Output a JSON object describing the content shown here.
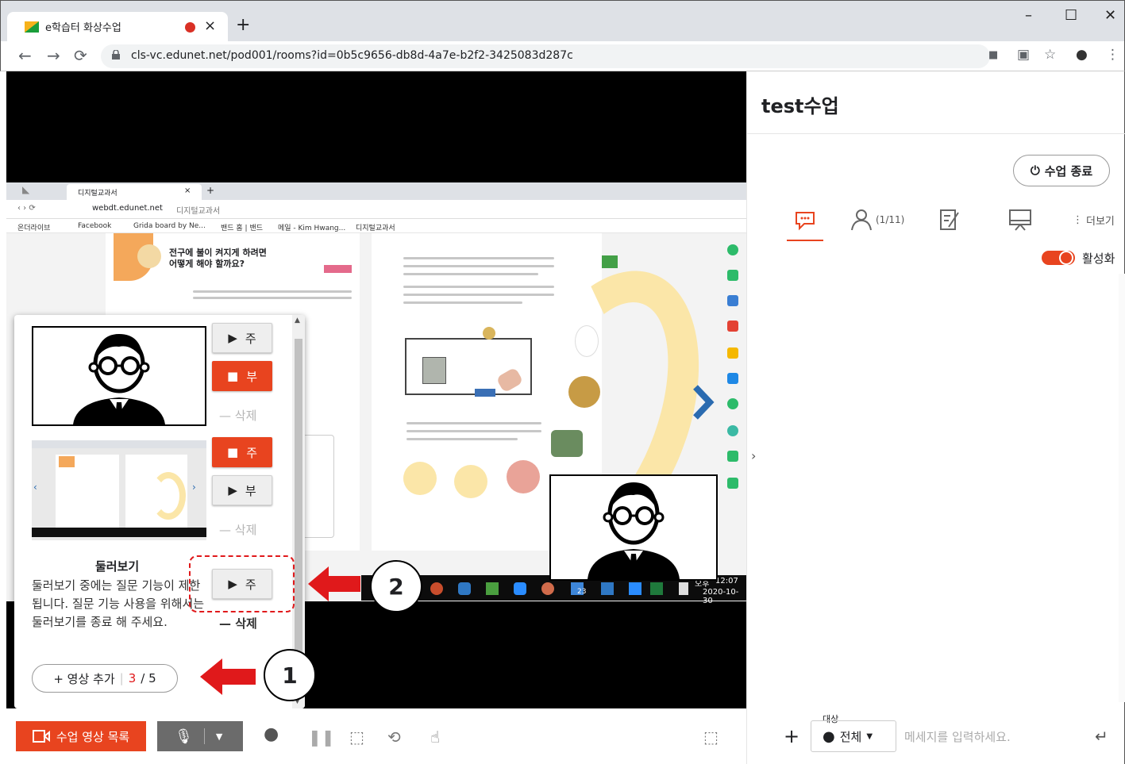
{
  "browser": {
    "tab_title": "e학습터 화상수업",
    "close_tab": "×",
    "new_tab": "+",
    "url": "cls-vc.edunet.net/pod001/rooms?id=0b5c9656-db8d-4a7e-b2f2-3425083d287c",
    "window_minimize": "–",
    "window_maximize": "☐",
    "window_close": "✕"
  },
  "screenshare": {
    "tab_title": "디지털교과서",
    "url_host": "webdt.edunet.net",
    "url_title": "디지털교과서",
    "bookmarks": [
      "온더라이브",
      "Facebook",
      "Grida board by Ne...",
      "밴드 홈 | 밴드",
      "메일 - Kim Hwang...",
      "디지털교과서"
    ],
    "page_heading_line1": "전구에 불이 켜지게 하려면",
    "page_heading_line2": "어떻게 해야 할까요?",
    "taskbar_time": "12:07",
    "taskbar_date": "2020-10-30",
    "taskbar_ampm": "오후",
    "taskbar_badge": "23"
  },
  "video_list": {
    "items": [
      {
        "main_button": "주",
        "sub_button": "부",
        "delete": "삭제"
      },
      {
        "main_button": "주",
        "sub_button": "부",
        "delete": "삭제"
      },
      {
        "main_button": "주",
        "delete": "삭제"
      }
    ],
    "browse_title": "둘러보기",
    "browse_desc": "둘러보기 중에는 질문 기능이 제한됩니다. 질문 기능 사용을 위해서는 둘러보기를 종료 해 주세요.",
    "add_video_label": "+ 영상 추가",
    "count_current": "3",
    "count_total": "/ 5"
  },
  "annotations": {
    "callout_1": "1",
    "callout_2": "2"
  },
  "toolbar": {
    "video_list_button": "수업 영상 목록"
  },
  "right_panel": {
    "class_title": "test수업",
    "end_class_button": "수업 종료",
    "participants_count": "(1/11)",
    "more_label": "더보기",
    "toggle_label": "활성화",
    "target_label": "대상",
    "target_value": "전체",
    "message_placeholder": "메세지를 입력하세요.",
    "add": "+",
    "send": "↵"
  },
  "colors": {
    "accent": "#e8441f",
    "annotation_red": "#e0191b"
  }
}
